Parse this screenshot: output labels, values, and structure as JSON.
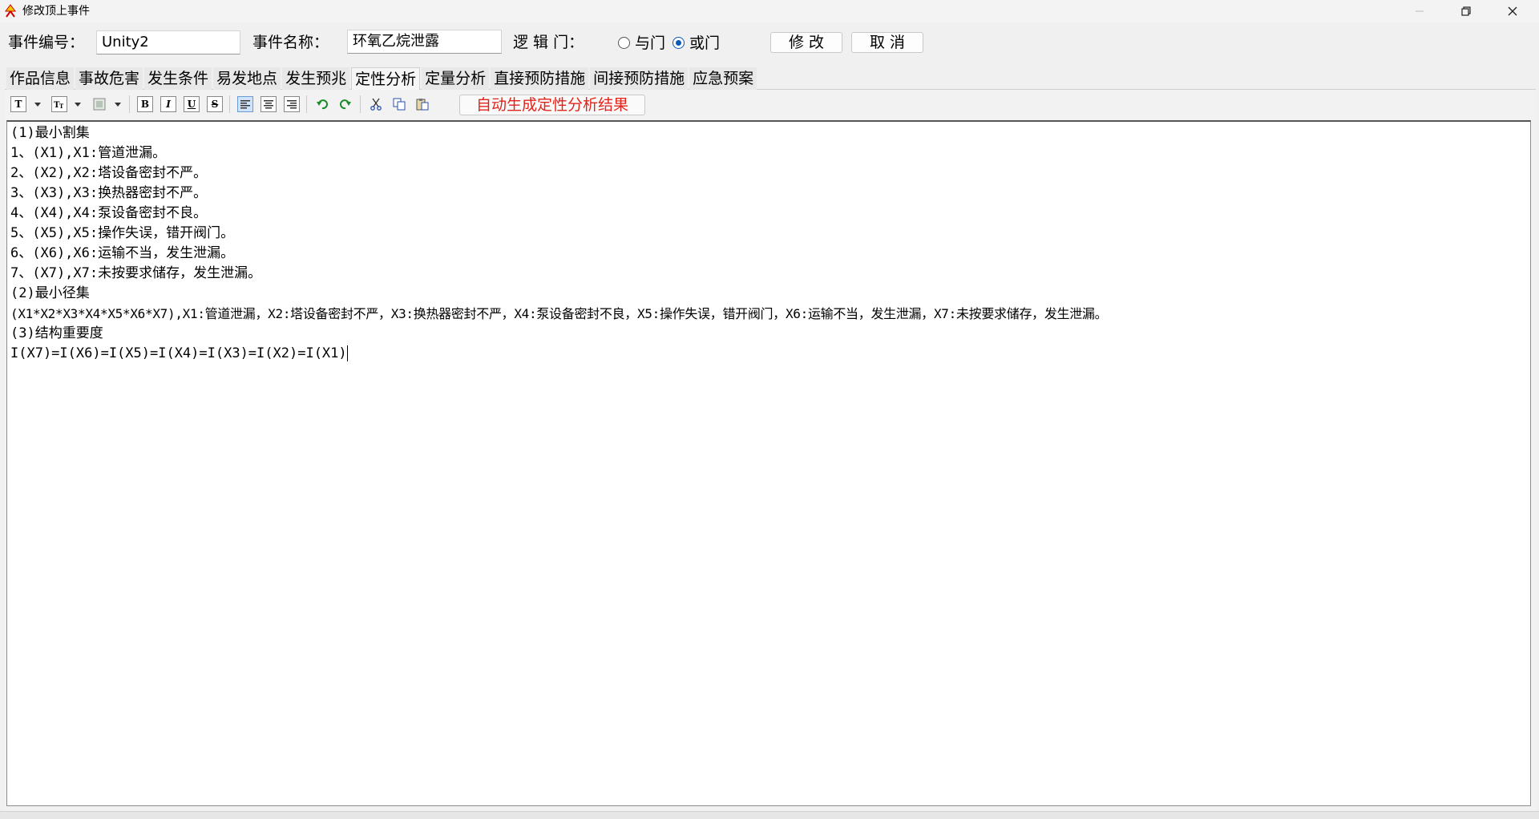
{
  "window": {
    "title": "修改顶上事件",
    "icon": "fault-tree-icon",
    "controls": [
      "minimize-icon",
      "restore-icon",
      "close-icon"
    ]
  },
  "header": {
    "event_id_label": "事件编号：",
    "event_id_value": "Unity2",
    "event_name_label": "事件名称：",
    "event_name_value": "环氧乙烷泄露",
    "logic_gate_label": "逻 辑 门：",
    "gate_options": [
      {
        "label": "与门",
        "checked": false
      },
      {
        "label": "或门",
        "checked": true
      }
    ],
    "modify_button": "修 改",
    "cancel_button": "取  消"
  },
  "tabs": [
    {
      "label": "作品信息",
      "active": false
    },
    {
      "label": "事故危害",
      "active": false
    },
    {
      "label": "发生条件",
      "active": false
    },
    {
      "label": "易发地点",
      "active": false
    },
    {
      "label": "发生预兆",
      "active": false
    },
    {
      "label": "定性分析",
      "active": true
    },
    {
      "label": "定量分析",
      "active": false
    },
    {
      "label": "直接预防措施",
      "active": false
    },
    {
      "label": "间接预防措施",
      "active": false
    },
    {
      "label": "应急预案",
      "active": false
    }
  ],
  "toolbar": {
    "icons": [
      "font-icon",
      "font-size-icon",
      "highlight-color-icon",
      "bold-icon",
      "italic-icon",
      "underline-icon",
      "strikethrough-icon",
      "align-left-icon",
      "align-center-icon",
      "align-right-icon",
      "undo-icon",
      "redo-icon",
      "cut-icon",
      "copy-icon",
      "paste-icon"
    ],
    "glyphs": {
      "bold": "B",
      "italic": "I",
      "underline": "U",
      "strike": "S",
      "font": "T"
    },
    "generate_button": "自动生成定性分析结果"
  },
  "editor": {
    "lines": [
      "(1)最小割集",
      "1、(X1),X1:管道泄漏。",
      "2、(X2),X2:塔设备密封不严。",
      "3、(X3),X3:换热器密封不严。",
      "4、(X4),X4:泵设备密封不良。",
      "5、(X5),X5:操作失误，错开阀门。",
      "6、(X6),X6:运输不当，发生泄漏。",
      "7、(X7),X7:未按要求储存，发生泄漏。",
      "(2)最小径集",
      "(X1*X2*X3*X4*X5*X6*X7),X1:管道泄漏，X2:塔设备密封不严，X3:换热器密封不严，X4:泵设备密封不良，X5:操作失误，错开阀门，X6:运输不当，发生泄漏，X7:未按要求储存，发生泄漏。",
      "(3)结构重要度",
      "I(X7)=I(X6)=I(X5)=I(X4)=I(X3)=I(X2)=I(X1)"
    ]
  },
  "colors": {
    "generate_button_text": "#e0241b",
    "radio_checked": "#0a59b8",
    "window_bg": "#f0f0f0"
  }
}
